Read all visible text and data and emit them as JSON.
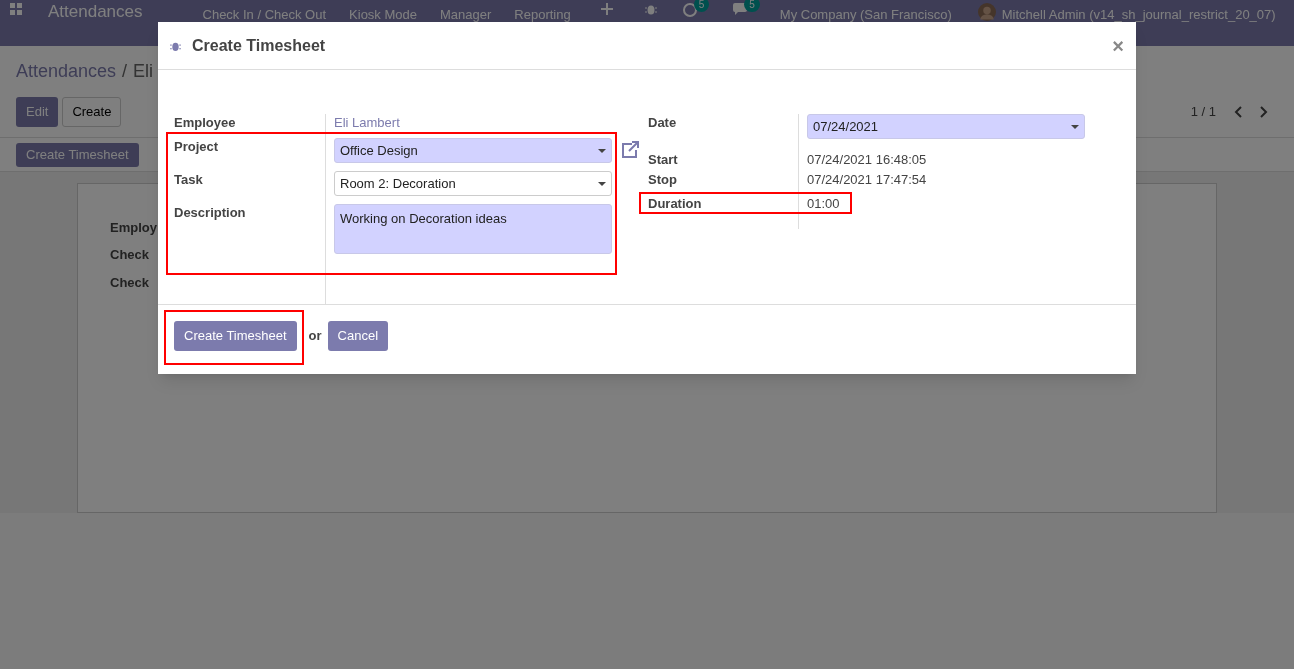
{
  "navbar": {
    "app_title": "Attendances",
    "menu": [
      "Check In / Check Out",
      "Kiosk Mode",
      "Manager",
      "Reporting"
    ],
    "activity_count": "5",
    "message_count": "5",
    "company": "My Company (San Francisco)",
    "user": "Mitchell Admin (v14_sh_journal_restrict_20_07)"
  },
  "breadcrumb": {
    "parent": "Attendances",
    "separator": "/",
    "current": "Eli"
  },
  "buttons": {
    "edit": "Edit",
    "create": "Create",
    "action": "Create Timesheet"
  },
  "pager": "1 / 1",
  "sheet_labels": [
    "Employ",
    "Check",
    "Check"
  ],
  "dialog": {
    "title": "Create Timesheet",
    "close": "×",
    "left_fields": [
      {
        "kind": "link",
        "label": "Employee",
        "value": "Eli Lambert"
      },
      {
        "kind": "select",
        "label": "Project",
        "value": "Office Design",
        "required": true
      },
      {
        "kind": "select",
        "label": "Task",
        "value": "Room 2: Decoration",
        "required": false
      },
      {
        "kind": "textarea",
        "label": "Description",
        "value": "Working on Decoration ideas",
        "required": true
      }
    ],
    "right_fields": [
      {
        "kind": "select",
        "label": "Date",
        "value": "07/24/2021",
        "required": true
      },
      {
        "kind": "text",
        "label": "Start",
        "value": "07/24/2021 16:48:05"
      },
      {
        "kind": "text",
        "label": "Stop",
        "value": "07/24/2021 17:47:54"
      },
      {
        "kind": "text",
        "label": "Duration",
        "value": "01:00"
      }
    ],
    "submit": "Create Timesheet",
    "or": "or",
    "cancel": "Cancel"
  }
}
